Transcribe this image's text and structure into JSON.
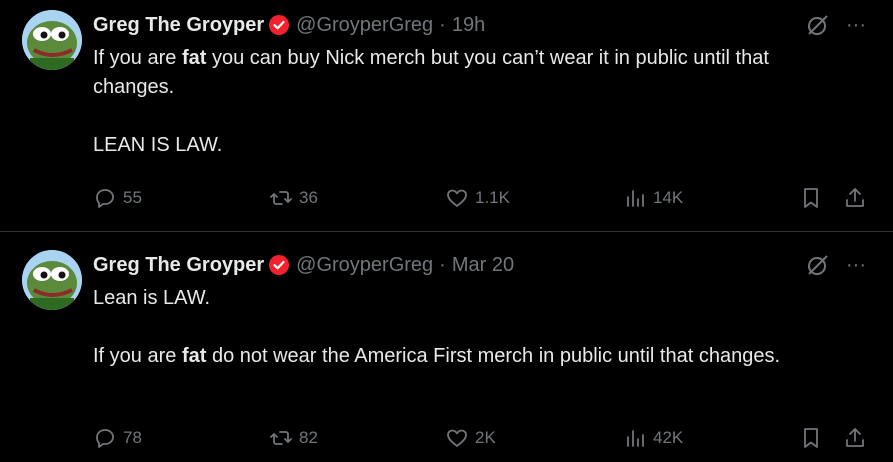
{
  "tweets": [
    {
      "name": "Greg The Groyper",
      "handle": "@GroyperGreg",
      "separator": "·",
      "time": "19h",
      "body": {
        "p1_pre": "If you are ",
        "p1_bold": "fat",
        "p1_post": " you can buy Nick merch but you can’t wear it in public until that changes.",
        "p2": "LEAN IS LAW."
      },
      "stats": {
        "replies": "55",
        "retweets": "36",
        "likes": "1.1K",
        "views": "14K"
      }
    },
    {
      "name": "Greg The Groyper",
      "handle": "@GroyperGreg",
      "separator": "·",
      "time": "Mar 20",
      "body": {
        "p1": "Lean is LAW.",
        "p2_pre": "If you are ",
        "p2_bold": "fat",
        "p2_post": " do not wear the America First merch in public until that changes."
      },
      "stats": {
        "replies": "78",
        "retweets": "82",
        "likes": "2K",
        "views": "42K"
      }
    }
  ],
  "more_label": "···",
  "colors": {
    "background": "#000000",
    "text": "#e7e9ea",
    "muted": "#71767b",
    "divider": "#2f3336",
    "badge": "#f4212e"
  },
  "icons": [
    "avatar-pepe",
    "verified-badge-icon",
    "grok-icon",
    "more-icon",
    "reply-icon",
    "retweet-icon",
    "like-icon",
    "views-icon",
    "bookmark-icon",
    "share-icon"
  ]
}
